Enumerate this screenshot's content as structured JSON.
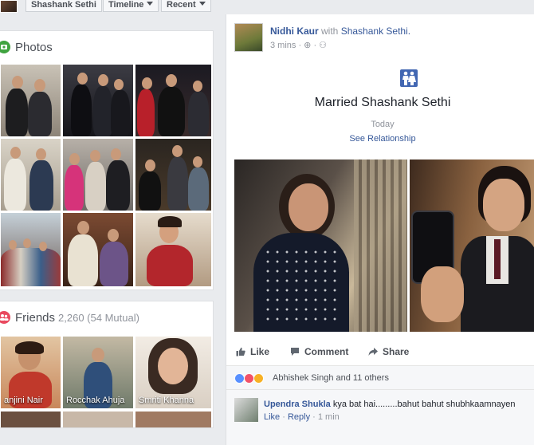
{
  "topbar": {
    "profile_name": "Shashank Sethi",
    "timeline_label": "Timeline",
    "recent_label": "Recent"
  },
  "photos": {
    "title": "Photos",
    "icon": "photos-icon",
    "icon_color": "#3fa33f"
  },
  "friends": {
    "title": "Friends",
    "count": "2,260 (54 Mutual)",
    "icon": "friends-icon",
    "icon_color": "#e9495f",
    "items": [
      {
        "name": "anjini Nair"
      },
      {
        "name": "Rocchak Ahuja"
      },
      {
        "name": "Smriti Khanna"
      }
    ]
  },
  "post": {
    "author": "Nidhi Kaur",
    "with_text": "with",
    "tagged": "Shashank Sethi.",
    "meta": "3 mins · ⊕ · ⚇",
    "event_title": "Married Shashank Sethi",
    "event_date": "Today",
    "event_link": "See Relationship",
    "event_icon": "relationship-icon",
    "like_label": "Like",
    "comment_label": "Comment",
    "share_label": "Share",
    "reactions_text": "Abhishek Singh and 11 others",
    "comment": {
      "author": "Upendra Shukla",
      "text": "kya bat hai.........bahut bahut shubhkaamnayen",
      "like_label": "Like",
      "reply_label": "Reply",
      "time": "1 min"
    }
  },
  "colors": {
    "link": "#365899",
    "meta": "#90949c",
    "background": "#e9ebee"
  }
}
